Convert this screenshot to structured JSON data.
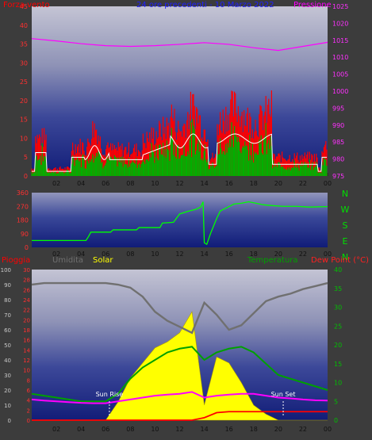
{
  "header": {
    "left": "Forza vento",
    "center": "24 ore precedenti - 10 Marzo 2022",
    "right": "Pressione"
  },
  "colors": {
    "wind_max": "#ff0000",
    "wind_avg": "#00b000",
    "wind_gust_line": "#ffffff",
    "pressure": "#ff00ff",
    "direction": "#00ff00",
    "rain": "#ff0000",
    "humidity": "#707070",
    "solar": "#ffff00",
    "temperature": "#00a000",
    "dewpoint": "#ff00ff",
    "dew_label": "#ff2020"
  },
  "chart_data": [
    {
      "type": "line",
      "name": "wind-pressure",
      "x_ticks": [
        "02",
        "04",
        "06",
        "08",
        "10",
        "12",
        "14",
        "16",
        "18",
        "20",
        "22",
        "00"
      ],
      "y_left": {
        "label": "Forza vento",
        "ticks": [
          0,
          5,
          10,
          15,
          20,
          25,
          30,
          35,
          40,
          45
        ],
        "lim": [
          0,
          45
        ]
      },
      "y_right": {
        "label": "Pressione",
        "ticks": [
          975,
          980,
          985,
          990,
          995,
          1000,
          1005,
          1010,
          1015,
          1020,
          1025
        ],
        "lim": [
          975,
          1025
        ]
      },
      "x": [
        0,
        2,
        4,
        6,
        8,
        10,
        12,
        14,
        16,
        18,
        20,
        22,
        24
      ],
      "series": [
        {
          "name": "Pressione",
          "axis": "right",
          "values": [
            1015.5,
            1014.8,
            1014.0,
            1013.4,
            1013.2,
            1013.4,
            1013.8,
            1014.3,
            1013.8,
            1012.8,
            1012.0,
            1013.2,
            1014.4
          ]
        }
      ]
    },
    {
      "type": "line",
      "name": "wind-direction",
      "x_ticks": [
        "02",
        "04",
        "06",
        "08",
        "10",
        "12",
        "14",
        "16",
        "18",
        "20",
        "22",
        "00"
      ],
      "y_left": {
        "ticks": [
          0,
          90,
          180,
          270,
          360
        ],
        "lim": [
          0,
          360
        ]
      },
      "y_right_labels": [
        "N",
        "W",
        "S",
        "E",
        "N"
      ]
    },
    {
      "type": "line",
      "name": "temp-humidity-solar",
      "legend": [
        "Pioggia",
        "Umidita",
        "Solar",
        "Temperatura",
        "Dew Point (°C)"
      ],
      "x_ticks": [
        "02",
        "04",
        "06",
        "08",
        "10",
        "12",
        "14",
        "16",
        "18",
        "20",
        "22",
        "00"
      ],
      "y_axis_1": {
        "ticks": [
          0,
          10,
          20,
          30,
          40,
          50,
          60,
          70,
          80,
          90,
          100
        ],
        "lim": [
          0,
          100
        ]
      },
      "y_axis_2": {
        "ticks": [
          0,
          2,
          4,
          6,
          8,
          10,
          12,
          14,
          16,
          18,
          20,
          22,
          24,
          26,
          28,
          30
        ],
        "lim": [
          0,
          30
        ]
      },
      "y_right": {
        "ticks": [
          0,
          5,
          10,
          15,
          20,
          25,
          30,
          35,
          40
        ],
        "lim": [
          0,
          40
        ]
      },
      "annotations": [
        {
          "label": "Sun Rise",
          "x": 6.3
        },
        {
          "label": "Sun Set",
          "x": 20.4
        }
      ],
      "x": [
        0,
        1,
        2,
        3,
        4,
        5,
        6,
        7,
        8,
        9,
        10,
        11,
        12,
        13,
        14,
        15,
        16,
        17,
        18,
        19,
        20,
        21,
        22,
        23,
        24
      ],
      "series": [
        {
          "name": "Umidita",
          "values": [
            90,
            91,
            91,
            91,
            91,
            91,
            91,
            90,
            88,
            82,
            72,
            66,
            62,
            58,
            78,
            70,
            60,
            63,
            71,
            79,
            82,
            84,
            87,
            89,
            91
          ]
        },
        {
          "name": "Temperatura",
          "values": [
            7,
            6.5,
            6,
            5.5,
            5,
            5,
            5,
            7,
            11,
            14,
            16,
            18,
            19,
            19.5,
            16,
            18,
            19,
            19.5,
            18,
            15,
            12,
            11,
            10,
            9,
            8
          ]
        },
        {
          "name": "Dew Point (°C)",
          "values": [
            5.5,
            5.2,
            5,
            4.8,
            4.6,
            4.5,
            4.5,
            5,
            5.5,
            6,
            6.5,
            6.8,
            7,
            7.5,
            6,
            6.5,
            6.8,
            7,
            7,
            6.5,
            6,
            5.8,
            5.5,
            5.3,
            5.2
          ]
        },
        {
          "name": "Solar",
          "values": [
            0,
            0,
            0,
            0,
            0,
            0,
            0,
            12,
            28,
            38,
            48,
            52,
            58,
            72,
            10,
            42,
            38,
            25,
            10,
            4,
            0,
            0,
            0,
            0,
            0
          ]
        },
        {
          "name": "Pioggia",
          "values": [
            0,
            0,
            0,
            0,
            0,
            0,
            0,
            0,
            0,
            0,
            0,
            0,
            0,
            0,
            0.5,
            1.5,
            1.7,
            1.7,
            1.7,
            1.7,
            1.7,
            1.7,
            1.7,
            1.7,
            1.7
          ]
        }
      ]
    }
  ]
}
